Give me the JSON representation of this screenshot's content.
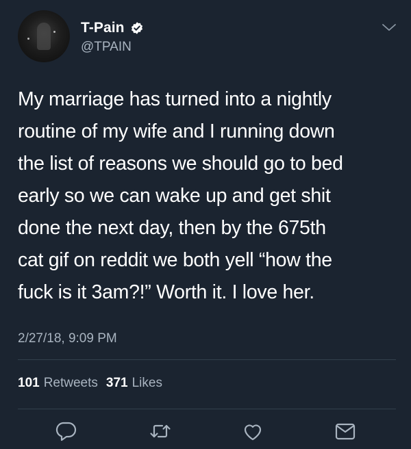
{
  "user": {
    "display_name": "T-Pain",
    "handle": "@TPAIN",
    "verified": true
  },
  "tweet": {
    "lines": [
      "My marriage has turned into a nightly",
      "routine of my wife and I running down",
      "the list of reasons we should go to bed",
      "early so we can wake up and get shit",
      "done the next day, then by the 675th",
      "cat gif on reddit we both yell “how the",
      "fuck is it 3am?!” Worth it. I love her."
    ],
    "timestamp": "2/27/18, 9:09 PM"
  },
  "stats": {
    "retweets_count": "101",
    "retweets_label": "Retweets",
    "likes_count": "371",
    "likes_label": "Likes"
  },
  "icons": {
    "verified": "verified-badge-icon",
    "menu": "chevron-down-icon",
    "reply": "reply-icon",
    "retweet": "retweet-icon",
    "like": "heart-icon",
    "message": "direct-message-icon"
  },
  "colors": {
    "background": "#1b2430",
    "text_primary": "#ffffff",
    "text_secondary": "#a9b4c0",
    "divider": "#33404d",
    "verified_badge": "#ffffff"
  }
}
